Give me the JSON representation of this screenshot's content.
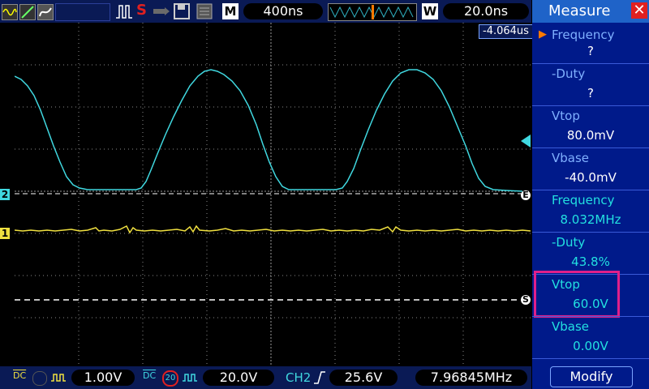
{
  "top": {
    "timebase_badge": "M",
    "timebase_value": "400ns",
    "window_badge": "W",
    "window_value": "20.0ns",
    "trigger_glyph": "S",
    "offset_value": "-4.064us"
  },
  "markers": {
    "ch2": "2",
    "ch1": "1",
    "e_marker": "E",
    "s_marker": "S"
  },
  "bottom": {
    "ch1_coupling": "DC",
    "ch1_volts": "1.00V",
    "ch2_coupling": "DC",
    "ch2_bw": "20",
    "ch2_volts": "20.0V",
    "trig_source": "CH2",
    "trig_level": "25.6V",
    "freq_readout": "7.96845MHz"
  },
  "panel": {
    "title": "Measure",
    "modify": "Modify",
    "items": [
      {
        "label": "Frequency",
        "value": "?",
        "color": "#7fb0ff"
      },
      {
        "label": "-Duty",
        "value": "?",
        "color": "#7fb0ff"
      },
      {
        "label": "Vtop",
        "value": "80.0mV",
        "color": "#7fb0ff"
      },
      {
        "label": "Vbase",
        "value": "-40.0mV",
        "color": "#7fb0ff"
      },
      {
        "label": "Frequency",
        "value": "8.032MHz",
        "color": "#22e0e0"
      },
      {
        "label": "-Duty",
        "value": "43.8%",
        "color": "#22e0e0"
      },
      {
        "label": "Vtop",
        "value": "60.0V",
        "color": "#22e0e0"
      },
      {
        "label": "Vbase",
        "value": "0.00V",
        "color": "#22e0e0"
      }
    ]
  },
  "colors": {
    "ch1": "#f0e040",
    "ch2": "#40d8e0",
    "highlight": "#e0208a",
    "grid": "#9a9a9a"
  }
}
